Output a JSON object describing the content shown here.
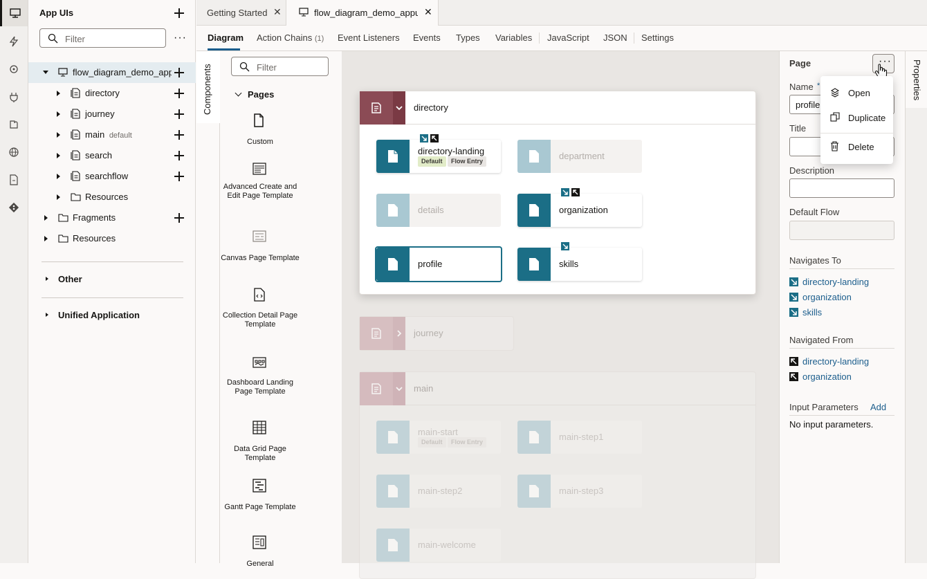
{
  "navigator": {
    "title": "App UIs",
    "filter_placeholder": "Filter",
    "app_name": "flow_diagram_demo_appui",
    "flows": [
      {
        "label": "directory",
        "suffix": ""
      },
      {
        "label": "journey",
        "suffix": ""
      },
      {
        "label": "main",
        "suffix": "default"
      },
      {
        "label": "search",
        "suffix": ""
      },
      {
        "label": "searchflow",
        "suffix": ""
      }
    ],
    "resources_label": "Resources",
    "fragments_label": "Fragments",
    "resources2_label": "Resources",
    "other_label": "Other",
    "unified_label": "Unified Application"
  },
  "tabs": [
    {
      "label": "Getting Started"
    },
    {
      "label": "flow_diagram_demo_appui"
    }
  ],
  "subtabs": {
    "diagram": "Diagram",
    "action_chains": "Action Chains",
    "action_chains_count": "(1)",
    "event_listeners": "Event Listeners",
    "events": "Events",
    "types": "Types",
    "variables": "Variables",
    "javascript": "JavaScript",
    "json": "JSON",
    "settings": "Settings"
  },
  "components": {
    "rail_label": "Components",
    "filter_placeholder": "Filter",
    "section": "Pages",
    "templates": [
      "Custom",
      "Advanced Create and Edit Page Template",
      "Canvas Page Template",
      "Collection Detail Page Template",
      "Dashboard Landing Page Template",
      "Data Grid Page Template",
      "Gantt Page Template",
      "General"
    ]
  },
  "diagram": {
    "directory": {
      "name": "directory",
      "pages": {
        "directory_landing": "directory-landing",
        "department": "department",
        "details": "details",
        "organization": "organization",
        "profile": "profile",
        "skills": "skills"
      },
      "badge_default": "Default",
      "badge_flow_entry": "Flow Entry"
    },
    "journey": {
      "name": "journey"
    },
    "main": {
      "name": "main",
      "pages": {
        "main_start": "main-start",
        "main_step1": "main-step1",
        "main_step2": "main-step2",
        "main_step3": "main-step3",
        "main_welcome": "main-welcome"
      },
      "badge_default": "Default",
      "badge_flow_entry": "Flow Entry"
    }
  },
  "properties": {
    "rail_label": "Properties",
    "title": "Page",
    "name_label": "Name",
    "name_value": "profile",
    "title_label": "Title",
    "description_label": "Description",
    "default_flow_label": "Default Flow",
    "navigates_to_label": "Navigates To",
    "navigates_to": [
      "directory-landing",
      "organization",
      "skills"
    ],
    "navigated_from_label": "Navigated From",
    "navigated_from": [
      "directory-landing",
      "organization"
    ],
    "input_params_label": "Input Parameters",
    "add_label": "Add",
    "no_params": "No input parameters."
  },
  "menu": {
    "open": "Open",
    "duplicate": "Duplicate",
    "delete": "Delete"
  },
  "colors": {
    "flow_header": "#8b4b55",
    "page_icon": "#1b6e86",
    "link": "#1b5d8c"
  }
}
